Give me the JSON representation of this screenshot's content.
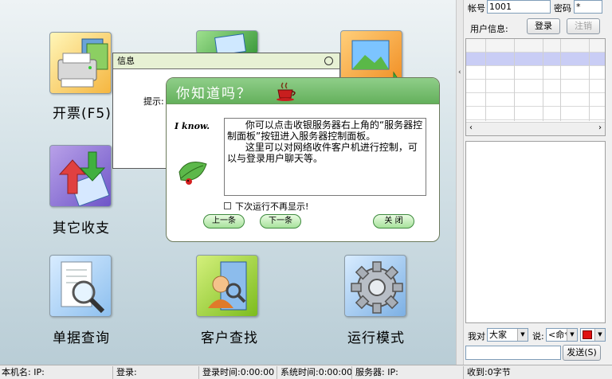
{
  "tiles": [
    {
      "label": "开票(F5)",
      "icon": "printer-icon"
    },
    {
      "label": "",
      "icon": "photo-icon"
    },
    {
      "label": "",
      "icon": "landscape-icon"
    },
    {
      "label": "其它收支",
      "icon": "transfer-arrows-icon"
    },
    {
      "label": "单据查询",
      "icon": "document-magnifier-icon"
    },
    {
      "label": "客户查找",
      "icon": "customer-search-icon"
    },
    {
      "label": "运行模式",
      "icon": "gear-icon"
    }
  ],
  "right": {
    "account_label": "帐号",
    "account_value": "1001",
    "password_label": "密码",
    "password_value": "*",
    "user_info_label": "用户信息:",
    "login_label": "登录",
    "logout_label": "注销",
    "to_label": "我对",
    "to_value": "大家",
    "say_label": "说:",
    "say_value": "<命令",
    "send_label": "发送(S)",
    "color_value": "#e01010"
  },
  "info_window": {
    "title": "信息",
    "prompt": "提示:"
  },
  "tip": {
    "title": "你知道吗？",
    "badge": "I know.",
    "message": "      你可以点击收银服务器右上角的“服务器控制面板”按钮进入服务器控制面板。\n      这里可以对网络收件客户机进行控制，可以与登录用户聊天等。",
    "checkbox_label": "下次运行不再显示!",
    "prev_label": "上一条",
    "next_label": "下一条",
    "close_label": "关 闭"
  },
  "status": {
    "local_name": "本机名: IP:",
    "login": "登录:",
    "login_time": "登录时间:0:00:00",
    "system_time": "系统时间:0:00:00",
    "server": "服务器: IP:",
    "received": "收到:0字节"
  }
}
